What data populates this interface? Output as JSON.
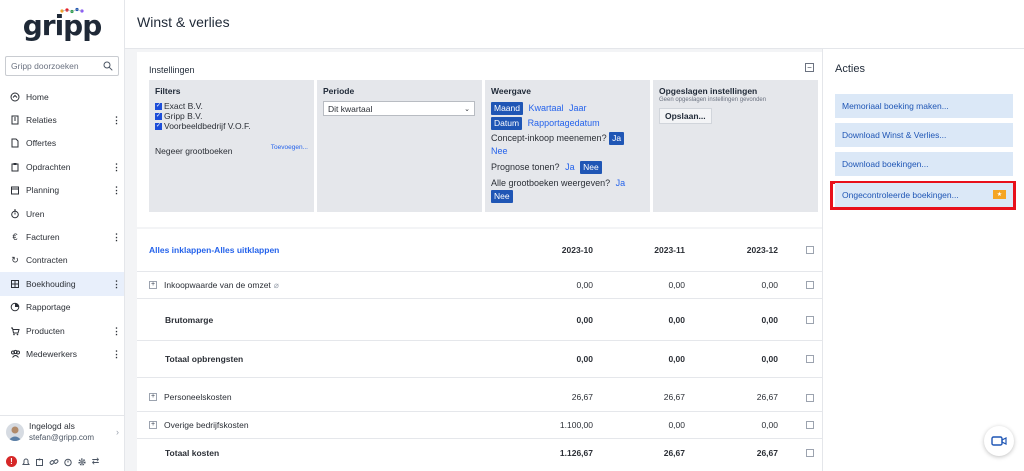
{
  "app": {
    "logo_text": "gripp"
  },
  "header": {
    "title": "Winst & verlies"
  },
  "search": {
    "placeholder": "Gripp doorzoeken"
  },
  "sidebar": {
    "items": [
      {
        "label": "Home",
        "icon": "home-icon",
        "more": false
      },
      {
        "label": "Relaties",
        "icon": "building-icon",
        "more": true
      },
      {
        "label": "Offertes",
        "icon": "document-icon",
        "more": false
      },
      {
        "label": "Opdrachten",
        "icon": "clipboard-icon",
        "more": true
      },
      {
        "label": "Planning",
        "icon": "calendar-icon",
        "more": true
      },
      {
        "label": "Uren",
        "icon": "stopwatch-icon",
        "more": false
      },
      {
        "label": "Facturen",
        "icon": "euro-icon",
        "more": true
      },
      {
        "label": "Contracten",
        "icon": "refresh-icon",
        "more": false
      },
      {
        "label": "Boekhouding",
        "icon": "ledger-icon",
        "more": true,
        "active": true
      },
      {
        "label": "Rapportage",
        "icon": "pie-chart-icon",
        "more": false
      },
      {
        "label": "Producten",
        "icon": "cart-icon",
        "more": true
      },
      {
        "label": "Medewerkers",
        "icon": "users-icon",
        "more": true
      }
    ]
  },
  "user": {
    "label": "Ingelogd als",
    "email": "stefan@gripp.com"
  },
  "settings": {
    "title": "Instellingen",
    "filters": {
      "heading": "Filters",
      "companies": [
        "Exact B.V.",
        "Gripp B.V.",
        "Voorbeeldbedrijf V.O.F."
      ],
      "ignore_label": "Negeer grootboeken",
      "add_link": "Toevoegen..."
    },
    "periode": {
      "heading": "Periode",
      "selected": "Dit kwartaal"
    },
    "weergave": {
      "heading": "Weergave",
      "options": [
        "Maand",
        "Kwartaal",
        "Jaar"
      ],
      "options2": [
        "Datum",
        "Rapportagedatum"
      ],
      "concept_label": "Concept-inkoop meenemen?",
      "prognose_label": "Prognose tonen?",
      "alle_label": "Alle grootboeken weergeven?",
      "ja": "Ja",
      "nee": "Nee"
    },
    "opgeslagen": {
      "heading": "Opgeslagen instellingen",
      "empty": "Geen opgeslagen instellingen gevonden",
      "save_button": "Opslaan..."
    }
  },
  "table": {
    "expand_link": "Alles inklappen-Alles uitklappen",
    "columns": [
      "2023-10",
      "2023-11",
      "2023-12"
    ],
    "rows": [
      {
        "label": "Inkoopwaarde van de omzet",
        "values": [
          "0,00",
          "0,00",
          "0,00"
        ],
        "expandable": true,
        "bold": false
      },
      {
        "label": "Brutomarge",
        "values": [
          "0,00",
          "0,00",
          "0,00"
        ],
        "expandable": false,
        "bold": true
      },
      {
        "label": "Totaal opbrengsten",
        "values": [
          "0,00",
          "0,00",
          "0,00"
        ],
        "expandable": false,
        "bold": true
      },
      {
        "label": "Personeelskosten",
        "values": [
          "26,67",
          "26,67",
          "26,67"
        ],
        "expandable": true,
        "bold": false
      },
      {
        "label": "Overige bedrijfskosten",
        "values": [
          "1.100,00",
          "0,00",
          "0,00"
        ],
        "expandable": true,
        "bold": false
      },
      {
        "label": "Totaal kosten",
        "values": [
          "1.126,67",
          "26,67",
          "26,67"
        ],
        "expandable": false,
        "bold": true
      }
    ]
  },
  "actions": {
    "title": "Acties",
    "buttons": [
      "Memoriaal boeking maken...",
      "Download Winst & Verlies...",
      "Download boekingen...",
      "Ongecontroleerde boekingen..."
    ]
  },
  "colors": {
    "accent": "#1f56b5",
    "highlight": "#e8101b",
    "badge": "#f5a524"
  }
}
